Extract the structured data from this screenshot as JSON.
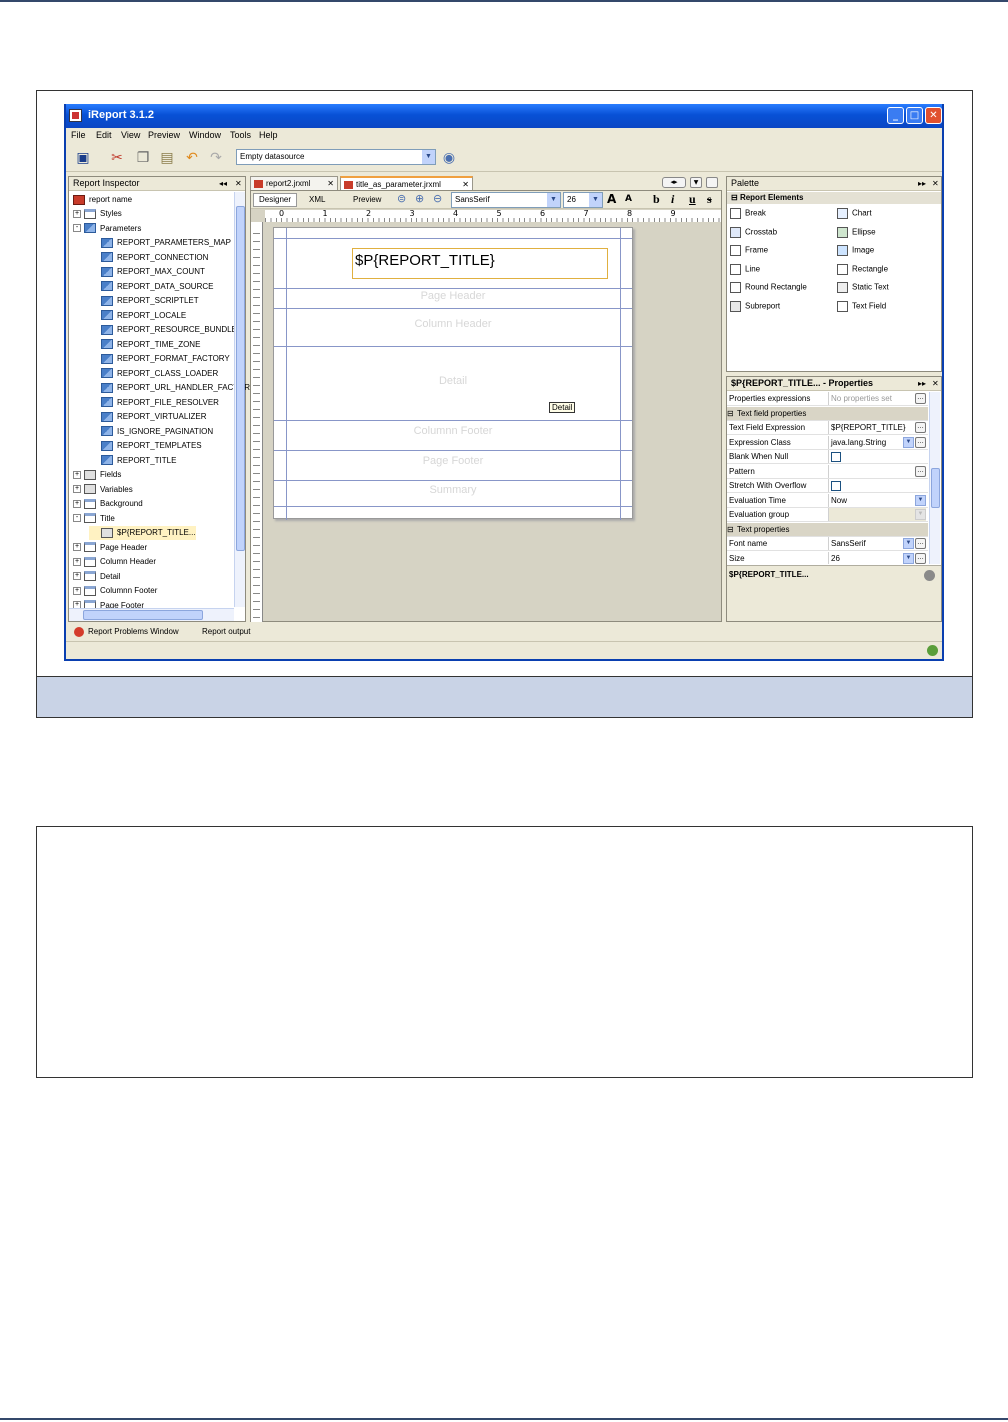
{
  "window": {
    "title": "iReport 3.1.2",
    "buttons": [
      "_",
      "□",
      "✕"
    ]
  },
  "menu": [
    "File",
    "Edit",
    "View",
    "Preview",
    "Window",
    "Tools",
    "Help"
  ],
  "toolbar": {
    "datasource": "Empty datasource"
  },
  "inspector": {
    "title": "Report Inspector",
    "root": "report name",
    "items": [
      {
        "label": "Styles",
        "level": 1,
        "exp": "+",
        "icon": "band"
      },
      {
        "label": "Parameters",
        "level": 1,
        "exp": "-",
        "icon": "param"
      },
      {
        "label": "REPORT_PARAMETERS_MAP",
        "level": 2,
        "icon": "param"
      },
      {
        "label": "REPORT_CONNECTION",
        "level": 2,
        "icon": "param"
      },
      {
        "label": "REPORT_MAX_COUNT",
        "level": 2,
        "icon": "param"
      },
      {
        "label": "REPORT_DATA_SOURCE",
        "level": 2,
        "icon": "param"
      },
      {
        "label": "REPORT_SCRIPTLET",
        "level": 2,
        "icon": "param"
      },
      {
        "label": "REPORT_LOCALE",
        "level": 2,
        "icon": "param"
      },
      {
        "label": "REPORT_RESOURCE_BUNDLE",
        "level": 2,
        "icon": "param"
      },
      {
        "label": "REPORT_TIME_ZONE",
        "level": 2,
        "icon": "param"
      },
      {
        "label": "REPORT_FORMAT_FACTORY",
        "level": 2,
        "icon": "param"
      },
      {
        "label": "REPORT_CLASS_LOADER",
        "level": 2,
        "icon": "param"
      },
      {
        "label": "REPORT_URL_HANDLER_FACTORY",
        "level": 2,
        "icon": "param"
      },
      {
        "label": "REPORT_FILE_RESOLVER",
        "level": 2,
        "icon": "param"
      },
      {
        "label": "REPORT_VIRTUALIZER",
        "level": 2,
        "icon": "param"
      },
      {
        "label": "IS_IGNORE_PAGINATION",
        "level": 2,
        "icon": "param"
      },
      {
        "label": "REPORT_TEMPLATES",
        "level": 2,
        "icon": "param"
      },
      {
        "label": "REPORT_TITLE",
        "level": 2,
        "icon": "param"
      },
      {
        "label": "Fields",
        "level": 1,
        "exp": "+",
        "icon": "field"
      },
      {
        "label": "Variables",
        "level": 1,
        "exp": "+",
        "icon": "field"
      },
      {
        "label": "Background",
        "level": 1,
        "exp": "+",
        "icon": "band"
      },
      {
        "label": "Title",
        "level": 1,
        "exp": "-",
        "icon": "band"
      },
      {
        "label": "$P{REPORT_TITLE...",
        "level": 2,
        "icon": "field",
        "selected": true
      },
      {
        "label": "Page Header",
        "level": 1,
        "exp": "+",
        "icon": "band"
      },
      {
        "label": "Column Header",
        "level": 1,
        "exp": "+",
        "icon": "band"
      },
      {
        "label": "Detail",
        "level": 1,
        "exp": "+",
        "icon": "band"
      },
      {
        "label": "Columnn Footer",
        "level": 1,
        "exp": "+",
        "icon": "band"
      },
      {
        "label": "Page Footer",
        "level": 1,
        "exp": "+",
        "icon": "band"
      }
    ]
  },
  "editor": {
    "tabs": [
      "report2.jrxml",
      "title_as_parameter.jrxml"
    ],
    "modes": [
      "Designer",
      "XML",
      "Preview"
    ],
    "font": "SansSerif",
    "size": "26",
    "format_buttons": [
      "b",
      "i",
      "u",
      "s"
    ],
    "ruler_numbers": [
      "0",
      "1",
      "2",
      "3",
      "4",
      "5",
      "6",
      "7",
      "8",
      "9"
    ],
    "title_field": "$P{REPORT_TITLE}",
    "bands": [
      "Page Header",
      "Column Header",
      "Detail",
      "Columnn Footer",
      "Page Footer",
      "Summary"
    ],
    "detail_tooltip": "Detail"
  },
  "palette": {
    "title": "Palette",
    "section": "Report Elements",
    "items": [
      "Break",
      "Chart",
      "Crosstab",
      "Ellipse",
      "Frame",
      "Image",
      "Line",
      "Rectangle",
      "Round Rectangle",
      "Static Text",
      "Subreport",
      "Text Field"
    ]
  },
  "properties": {
    "title": "$P{REPORT_TITLE... - Properties",
    "rows": [
      {
        "k": "Properties expressions",
        "v": "No properties set",
        "type": "btn"
      },
      {
        "k": "Text field properties",
        "section": true
      },
      {
        "k": "Text Field Expression",
        "v": "$P{REPORT_TITLE}",
        "type": "btn"
      },
      {
        "k": "Expression Class",
        "v": "java.lang.String",
        "type": "combo-btn"
      },
      {
        "k": "Blank When Null",
        "v": "",
        "type": "check"
      },
      {
        "k": "Pattern",
        "v": "",
        "type": "btn"
      },
      {
        "k": "Stretch With Overflow",
        "v": "",
        "type": "check"
      },
      {
        "k": "Evaluation Time",
        "v": "Now",
        "type": "combo"
      },
      {
        "k": "Evaluation group",
        "v": "",
        "type": "combo-disabled"
      },
      {
        "k": "Text properties",
        "section": true
      },
      {
        "k": "Font name",
        "v": "SansSerif",
        "type": "combo-btn"
      },
      {
        "k": "Size",
        "v": "26",
        "type": "combo-btn"
      }
    ],
    "footer": "$P{REPORT_TITLE..."
  },
  "status": {
    "tabs": [
      "Report Problems Window",
      "Report output"
    ]
  }
}
